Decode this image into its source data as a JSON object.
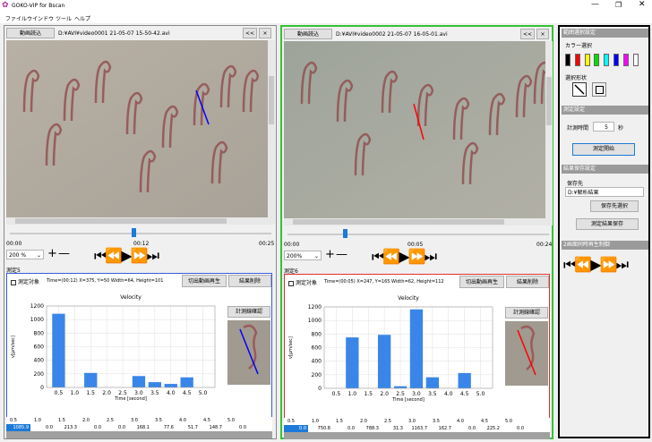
{
  "window": {
    "title": "GOKO-VIP for Bscan"
  },
  "menu": [
    "ファイル",
    "ウインドウ",
    "ツール",
    "ヘルプ"
  ],
  "panels": [
    {
      "load_label": "動画読込",
      "path": "D:¥AVI¥video0001 21-05-07 15-50-42.avi",
      "back_label": "<<",
      "close_label": "×",
      "time_start": "00:00",
      "time_current": "00:12",
      "time_end": "00:25",
      "zoom": "200 %",
      "measure_title": "測定5",
      "check_label": "測定対象",
      "info": "Time=(00:12) X=375, Y=50 Width=64, Height=101",
      "cut_label": "切出動画再生",
      "delete_label": "結果削除",
      "confirm_label": "計測線確認",
      "line_color": "#0000ff",
      "chart_data": {
        "type": "bar",
        "title": "Velocity",
        "xlabel": "Time [second]",
        "ylabel": "v[μm/sec]",
        "ylim": [
          0,
          1200
        ],
        "yticks": [
          0,
          200,
          400,
          600,
          800,
          1000,
          1200
        ],
        "categories": [
          "0.5",
          "1.0",
          "1.5",
          "2.0",
          "2.5",
          "3.0",
          "3.5",
          "4.0",
          "4.5",
          "5.0"
        ],
        "values": [
          1085.9,
          0.0,
          213.3,
          0.0,
          0.0,
          168.1,
          77.6,
          51.7,
          148.7,
          0.0
        ],
        "color": "#3a86e8"
      },
      "table_headers": [
        "0.5",
        "1.0",
        "1.5",
        "2.0",
        "2.5",
        "3.0",
        "3.5",
        "4.0",
        "4.5",
        "5.0"
      ],
      "table_values": [
        "1085.9",
        "0.0",
        "213.3",
        "0.0",
        "0.0",
        "168.1",
        "77.6",
        "51.7",
        "148.7",
        "0.0"
      ],
      "border_color": "#3a5bd8"
    },
    {
      "load_label": "動画読込",
      "path": "D:¥AVI¥video0002 21-05-07 16-05-01.avi",
      "back_label": "<<",
      "close_label": "×",
      "time_start": "00:00",
      "time_current": "00:05",
      "time_end": "00:24",
      "zoom": "200%",
      "measure_title": "測定6",
      "check_label": "測定対象",
      "info": "Time=(00:05) X=247, Y=165 Width=62, Height=112",
      "cut_label": "切出動画再生",
      "delete_label": "結果削除",
      "confirm_label": "計測線確認",
      "line_color": "#ff0000",
      "chart_data": {
        "type": "bar",
        "title": "Velocity",
        "xlabel": "Time [second]",
        "ylabel": "v[μm/sec]",
        "ylim": [
          0,
          1200
        ],
        "yticks": [
          0,
          200,
          400,
          600,
          800,
          1000,
          1200
        ],
        "categories": [
          "0.5",
          "1.0",
          "1.5",
          "2.0",
          "2.5",
          "3.0",
          "3.5",
          "4.0",
          "4.5",
          "5.0"
        ],
        "values": [
          0.0,
          750.8,
          0.0,
          788.3,
          31.3,
          1163.7,
          162.7,
          0.0,
          225.2,
          0.0
        ],
        "color": "#3a86e8"
      },
      "table_headers": [
        "0.5",
        "1.0",
        "1.5",
        "2.0",
        "2.5",
        "3.0",
        "3.5",
        "4.0",
        "4.5",
        "5.0"
      ],
      "table_values": [
        "0.0",
        "750.8",
        "0.0",
        "788.3",
        "31.3",
        "1163.7",
        "162.7",
        "0.0",
        "225.2",
        "0.0"
      ],
      "border_color": "#e03030"
    }
  ],
  "side": {
    "range_header": "範囲選択設定",
    "color_label": "カラー選択",
    "colors": [
      "#000000",
      "#ff0000",
      "#ffff00",
      "#00dd00",
      "#00ffff",
      "#0000ff",
      "#ff00ff",
      "#ffffff"
    ],
    "shape_label": "選択形状",
    "measure_header": "測定設定",
    "time_label": "計測時間",
    "time_value": "5",
    "time_unit": "秒",
    "start_label": "測定開始",
    "save_header": "結果保存設定",
    "dest_label": "保存先",
    "dest_value": "D:¥解析結果",
    "dest_select": "保存先選択",
    "save_button": "測定結果保存",
    "sync_header": "2画面同時再生制御"
  }
}
